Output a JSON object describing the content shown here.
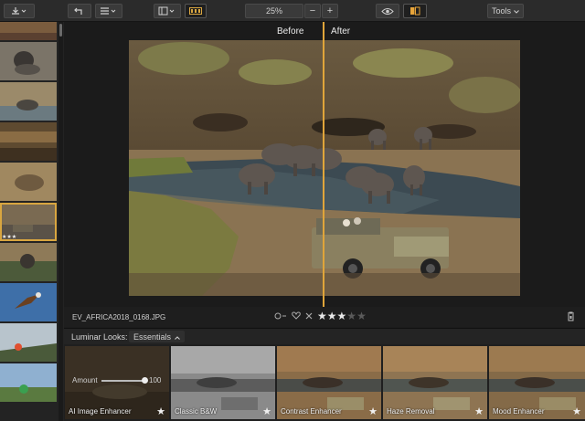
{
  "toolbar": {
    "zoom_value": "25%",
    "zoom_out_label": "−",
    "zoom_in_label": "+",
    "tools_label": "Tools",
    "icons": [
      "export-icon",
      "undo-icon",
      "menu-list-icon",
      "layout-icon",
      "filmstrip-icon",
      "eye-icon",
      "compare-icon",
      "chevron-down-icon"
    ]
  },
  "filmstrip": {
    "selected_index": 5,
    "selected_stars": "★★★"
  },
  "viewer": {
    "before_label": "Before",
    "after_label": "After"
  },
  "infobar": {
    "filename": "EV_AFRICA2018_0168.JPG",
    "rating": 3,
    "max_rating": 5,
    "reject_icon": "x-icon",
    "like_icon": "heart-icon",
    "label_icon": "circle-icon"
  },
  "looks": {
    "title": "Luminar Looks:",
    "category": "Essentials",
    "items": [
      {
        "name": "AI Image Enhancer",
        "star": "★",
        "amount_label": "Amount",
        "amount_value": "100"
      },
      {
        "name": "Classic B&W",
        "star": "★"
      },
      {
        "name": "Contrast Enhancer",
        "star": "★"
      },
      {
        "name": "Haze Removal",
        "star": "★"
      },
      {
        "name": "Mood Enhancer",
        "star": "★"
      }
    ]
  },
  "colors": {
    "accent": "#d9a640",
    "background": "#1c1c1c"
  }
}
